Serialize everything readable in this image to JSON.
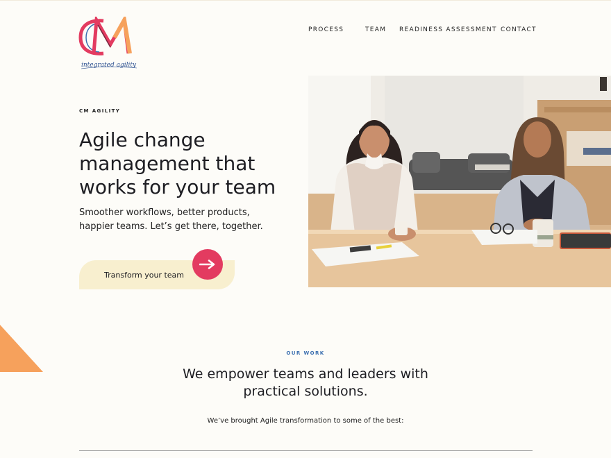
{
  "brand": {
    "logo_letters": "CM",
    "tagline": "integrated agility"
  },
  "nav": {
    "items": [
      {
        "label": "PROCESS"
      },
      {
        "label": "TEAM"
      },
      {
        "label": "READINESS ASSESSMENT"
      },
      {
        "label": "CONTACT"
      }
    ]
  },
  "hero": {
    "eyebrow": "CM AGILITY",
    "title": "Agile change management that works for your team",
    "subtitle": "Smoother workflows, better products, happier teams. Let’s get there, together.",
    "cta_label": "Transform your team"
  },
  "our_work": {
    "eyebrow": "OUR WORK",
    "title": "We empower teams and leaders with practical solutions.",
    "subtitle": "We’ve brought Agile transformation to some of the best:"
  },
  "colors": {
    "background": "#fdfcf8",
    "accent_pink": "#e33b60",
    "accent_orange": "#f6a15c",
    "cta_bg": "#f8efcf",
    "link_blue": "#3b6fb0"
  },
  "icons": {
    "cta": "arrow-right-icon",
    "decoration": "orange-triangle"
  }
}
